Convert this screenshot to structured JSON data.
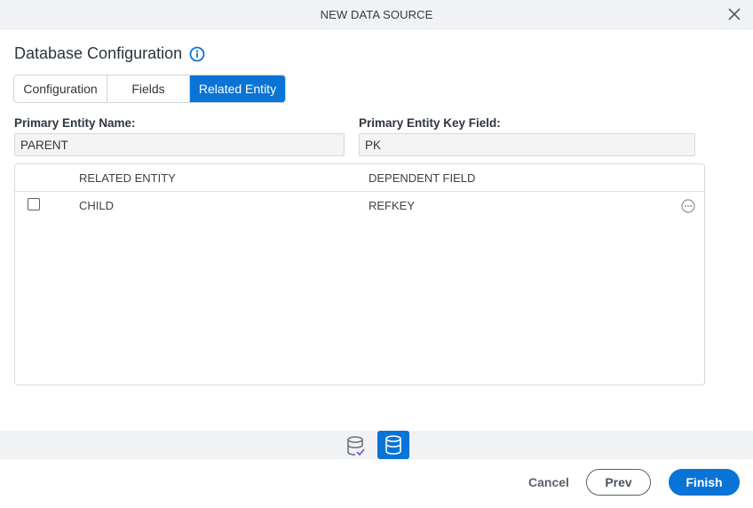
{
  "dialog": {
    "title": "NEW DATA SOURCE"
  },
  "section": {
    "heading": "Database Configuration"
  },
  "tabs": [
    {
      "label": "Configuration",
      "active": false
    },
    {
      "label": "Fields",
      "active": false
    },
    {
      "label": "Related Entity",
      "active": true
    }
  ],
  "form": {
    "primary_entity_name_label": "Primary Entity Name:",
    "primary_entity_name_value": "PARENT",
    "primary_entity_key_label": "Primary Entity Key Field:",
    "primary_entity_key_value": "PK"
  },
  "grid": {
    "columns": [
      "RELATED ENTITY",
      "DEPENDENT FIELD"
    ],
    "rows": [
      {
        "related_entity": "CHILD",
        "dependent_field": "REFKEY",
        "checked": false
      }
    ]
  },
  "footer": {
    "cancel_label": "Cancel",
    "prev_label": "Prev",
    "finish_label": "Finish"
  },
  "colors": {
    "accent": "#0a74d6"
  }
}
